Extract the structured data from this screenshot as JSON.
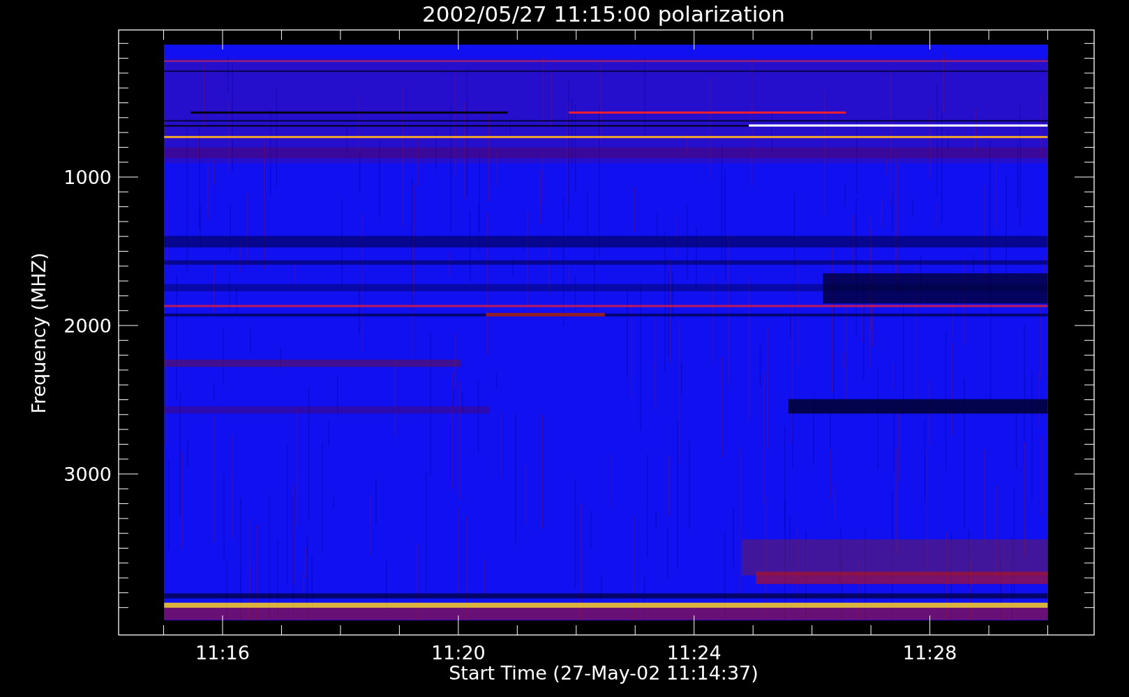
{
  "chart": {
    "title": "2002/05/27 11:15:00 polarization",
    "xlabel": "Start Time (27-May-02 11:14:37)",
    "ylabel": "Frequency (MHZ)",
    "yticks": [
      "1000",
      "2000",
      "3000"
    ],
    "xticks": [
      "11:16",
      "11:20",
      "11:24",
      "11:28"
    ]
  }
}
